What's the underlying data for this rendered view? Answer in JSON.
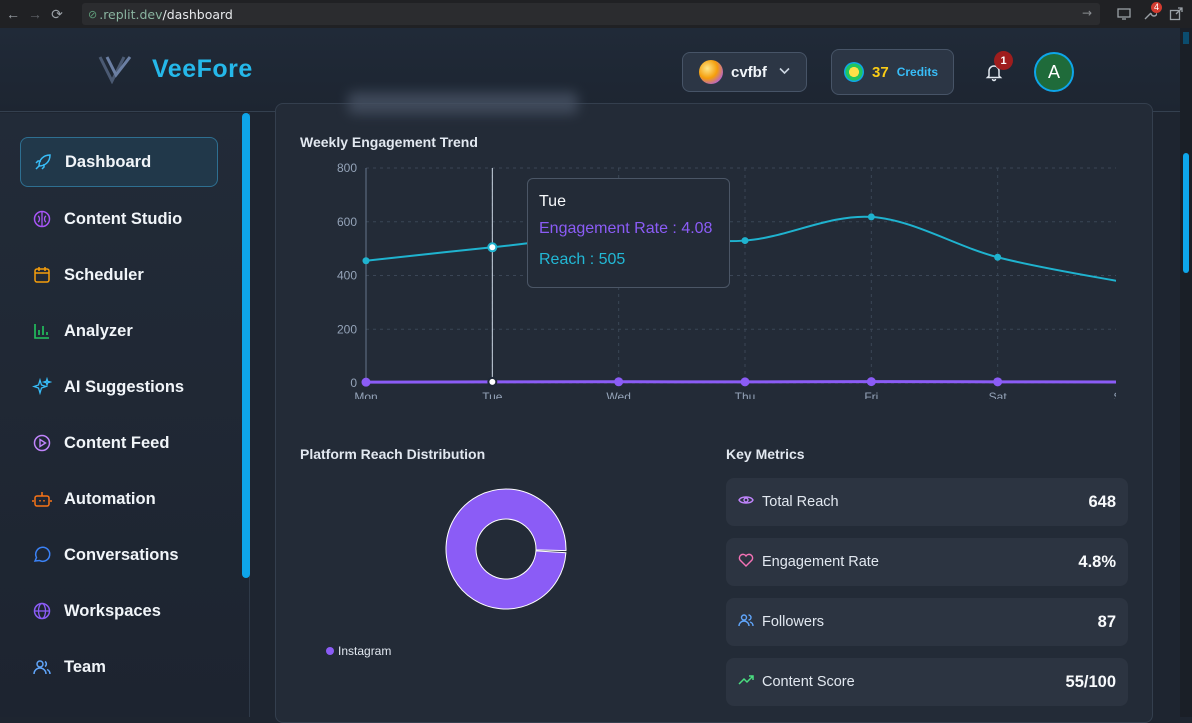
{
  "browser": {
    "url_host": ".replit.dev",
    "url_path": "/dashboard",
    "ext_badge": "4"
  },
  "header": {
    "brand": "VeeFore",
    "workspace": "cvfbf",
    "credits_value": "37",
    "credits_label": "Credits",
    "notif_count": "1",
    "user_initial": "A"
  },
  "sidebar": {
    "items": [
      {
        "label": "Dashboard",
        "icon": "rocket-icon",
        "color": "#38bdf8"
      },
      {
        "label": "Content Studio",
        "icon": "brain-icon",
        "color": "#a855f7"
      },
      {
        "label": "Scheduler",
        "icon": "calendar-icon",
        "color": "#f59e0b"
      },
      {
        "label": "Analyzer",
        "icon": "bar-chart-icon",
        "color": "#22c55e"
      },
      {
        "label": "AI Suggestions",
        "icon": "sparkles-icon",
        "color": "#38bdf8"
      },
      {
        "label": "Content Feed",
        "icon": "play-circle-icon",
        "color": "#c084fc"
      },
      {
        "label": "Automation",
        "icon": "bot-icon",
        "color": "#f97316"
      },
      {
        "label": "Conversations",
        "icon": "chat-icon",
        "color": "#3b82f6"
      },
      {
        "label": "Workspaces",
        "icon": "globe-icon",
        "color": "#8b5cf6"
      },
      {
        "label": "Team",
        "icon": "users-icon",
        "color": "#60a5fa"
      }
    ]
  },
  "main": {
    "trend_title": "Weekly Engagement Trend",
    "tooltip": {
      "day": "Tue",
      "engagement": "Engagement Rate : 4.08",
      "reach": "Reach : 505"
    },
    "distribution_title": "Platform Reach Distribution",
    "legend_label": "Instagram",
    "metrics_title": "Key Metrics",
    "metrics": [
      {
        "label": "Total Reach",
        "value": "648",
        "icon": "eye-icon",
        "color": "#c084fc"
      },
      {
        "label": "Engagement Rate",
        "value": "4.8%",
        "icon": "heart-icon",
        "color": "#f472b6"
      },
      {
        "label": "Followers",
        "value": "87",
        "icon": "users-icon",
        "color": "#60a5fa"
      },
      {
        "label": "Content Score",
        "value": "55/100",
        "icon": "trending-up-icon",
        "color": "#4ade80"
      }
    ]
  },
  "chart_data": [
    {
      "type": "line",
      "title": "Weekly Engagement Trend",
      "categories": [
        "Mon",
        "Tue",
        "Wed",
        "Thu",
        "Fri",
        "Sat",
        "Sun"
      ],
      "yticks": [
        "0",
        "200",
        "400",
        "600",
        "800"
      ],
      "ylim": [
        0,
        800
      ],
      "grid": true,
      "series": [
        {
          "name": "Reach",
          "color": "#1fb3cf",
          "values": [
            455,
            505,
            550,
            530,
            618,
            468,
            375
          ]
        },
        {
          "name": "Engagement Rate",
          "color": "#8b5cf6",
          "values": [
            3.2,
            4.08,
            4.5,
            4.2,
            5.1,
            4.4,
            3.6
          ]
        }
      ]
    },
    {
      "type": "pie",
      "title": "Platform Reach Distribution",
      "categories": [
        "Instagram"
      ],
      "values": [
        100
      ],
      "colors": [
        "#8b5cf6"
      ]
    }
  ]
}
